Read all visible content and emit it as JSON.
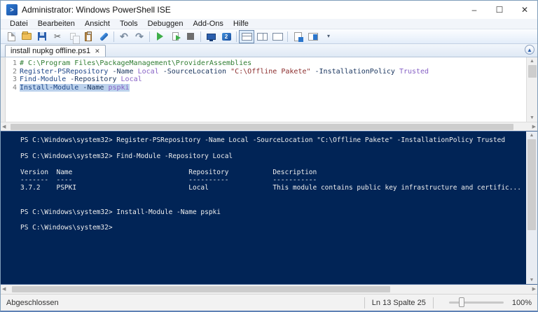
{
  "window": {
    "title": "Administrator: Windows PowerShell ISE",
    "controls": {
      "minimize": "–",
      "maximize": "☐",
      "close": "✕"
    }
  },
  "menu": {
    "items": [
      "Datei",
      "Bearbeiten",
      "Ansicht",
      "Tools",
      "Debuggen",
      "Add-Ons",
      "Hilfe"
    ]
  },
  "editor": {
    "tab": "install nupkg offline.ps1",
    "tab_close": "✕",
    "lines": [
      {
        "n": "1",
        "selected": false,
        "tokens": [
          [
            "# C:\\Program Files\\PackageManagement\\ProviderAssemblies",
            "comment"
          ]
        ]
      },
      {
        "n": "2",
        "selected": false,
        "tokens": [
          [
            "Register-PSRepository",
            "command"
          ],
          [
            " ",
            "plain"
          ],
          [
            "-Name",
            "param"
          ],
          [
            " ",
            "plain"
          ],
          [
            "Local",
            "arg"
          ],
          [
            " ",
            "plain"
          ],
          [
            "-SourceLocation",
            "param"
          ],
          [
            " ",
            "plain"
          ],
          [
            "\"C:\\Offline Pakete\"",
            "string"
          ],
          [
            " ",
            "plain"
          ],
          [
            "-InstallationPolicy",
            "param"
          ],
          [
            " ",
            "plain"
          ],
          [
            "Trusted",
            "arg"
          ]
        ]
      },
      {
        "n": "3",
        "selected": false,
        "tokens": [
          [
            "Find-Module",
            "command"
          ],
          [
            " ",
            "plain"
          ],
          [
            "-Repository",
            "param"
          ],
          [
            " ",
            "plain"
          ],
          [
            "Local",
            "arg"
          ]
        ]
      },
      {
        "n": "4",
        "selected": true,
        "tokens": [
          [
            "Install-Module",
            "command"
          ],
          [
            " ",
            "plain"
          ],
          [
            "-Name",
            "param"
          ],
          [
            " ",
            "plain"
          ],
          [
            "pspki",
            "arg"
          ]
        ]
      }
    ]
  },
  "console": {
    "background": "#012456",
    "lines": [
      "PS C:\\Windows\\system32> Register-PSRepository -Name Local -SourceLocation \"C:\\Offline Pakete\" -InstallationPolicy Trusted",
      "",
      "PS C:\\Windows\\system32> Find-Module -Repository Local",
      "",
      "Version  Name                             Repository           Description",
      "-------  ----                             ----------           -----------",
      "3.7.2    PSPKI                            Local                This module contains public key infrastructure and certific...",
      "",
      "",
      "PS C:\\Windows\\system32> Install-Module -Name pspki",
      "",
      "PS C:\\Windows\\system32>"
    ]
  },
  "status": {
    "state": "Abgeschlossen",
    "position": "Ln 13 Spalte 25",
    "zoom": "100%"
  },
  "colors": {
    "console_bg": "#012456",
    "accent_blue": "#2b5fad",
    "comment": "#2f7d32",
    "command": "#1c4587",
    "argument": "#8661c5",
    "string": "#8b2c2c"
  }
}
